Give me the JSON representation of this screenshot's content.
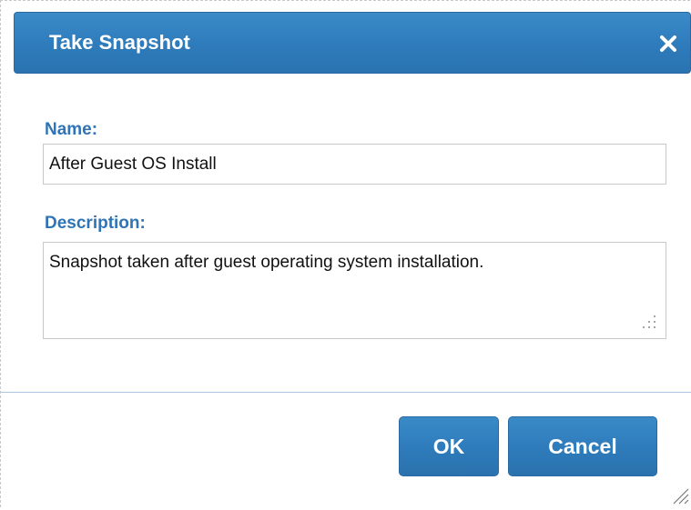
{
  "dialog": {
    "title": "Take Snapshot",
    "close_icon": "close-icon"
  },
  "form": {
    "name_label": "Name:",
    "name_value": "After Guest OS Install",
    "description_label": "Description:",
    "description_value": "Snapshot taken after guest operating system installation."
  },
  "buttons": {
    "ok_label": "OK",
    "cancel_label": "Cancel"
  },
  "colors": {
    "accent": "#2e7bbb",
    "label": "#2f74b5",
    "divider": "#a9c7e3"
  }
}
